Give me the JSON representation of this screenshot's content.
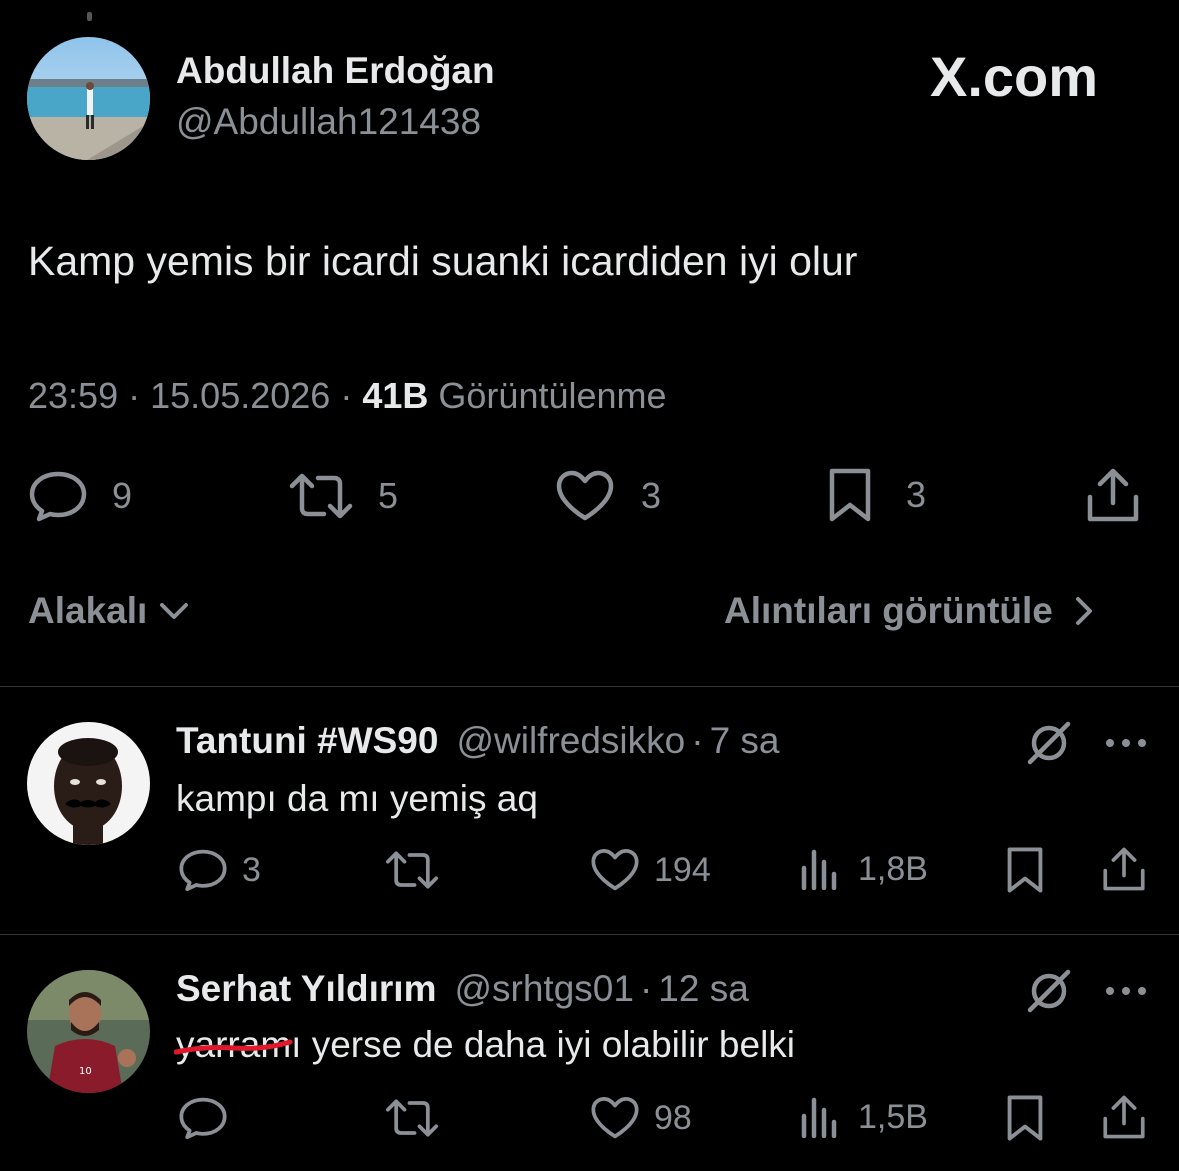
{
  "main_tweet": {
    "author_name": "Abdullah Erdoğan",
    "author_handle": "@Abdullah121438",
    "brand": "X.com",
    "text": "Kamp yemis bir icardi suanki icardiden iyi olur",
    "time": "23:59",
    "date": "15.05.2026",
    "views_count": "41B",
    "views_label": "Görüntülenme",
    "separator": "·",
    "replies": "9",
    "retweets": "5",
    "likes": "3",
    "bookmarks": "3"
  },
  "sort_bar": {
    "sort_label": "Alakalı",
    "quotes_label": "Alıntıları görüntüle"
  },
  "replies": [
    {
      "name": "Tantuni #WS90",
      "handle": "@wilfredsikko",
      "time": "7 sa",
      "text": "kampı da mı yemiş aq",
      "reply_count": "3",
      "like_count": "194",
      "view_count": "1,8B"
    },
    {
      "name": "Serhat Yıldırım",
      "handle": "@srhtgs01",
      "time": "12 sa",
      "text_struck": "yarra",
      "text": "mı yerse de daha iyi olabilir belki",
      "like_count": "98",
      "view_count": "1,5B"
    }
  ],
  "colors": {
    "background": "#000000",
    "text_primary": "#e7e9ea",
    "text_secondary": "#8b9096",
    "divider": "#2f3336",
    "scribble": "#e0182b"
  }
}
